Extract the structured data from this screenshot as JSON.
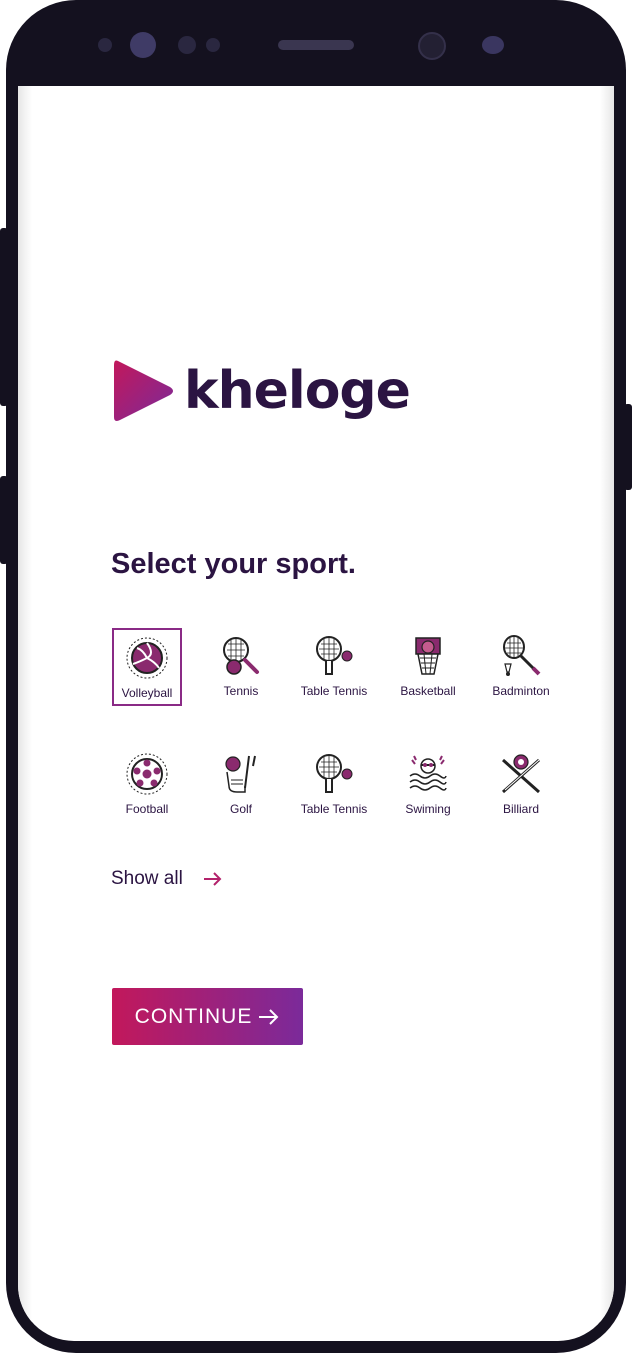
{
  "app": {
    "logo_text": "kheloge"
  },
  "heading": "Select your sport.",
  "sports": [
    {
      "label": "Volleyball",
      "icon": "volleyball-icon",
      "selected": true
    },
    {
      "label": "Tennis",
      "icon": "tennis-icon",
      "selected": false
    },
    {
      "label": "Table Tennis",
      "icon": "table-tennis-icon",
      "selected": false
    },
    {
      "label": "Basketball",
      "icon": "basketball-icon",
      "selected": false
    },
    {
      "label": "Badminton",
      "icon": "badminton-icon",
      "selected": false
    },
    {
      "label": "Football",
      "icon": "football-icon",
      "selected": false
    },
    {
      "label": "Golf",
      "icon": "golf-icon",
      "selected": false
    },
    {
      "label": "Table Tennis",
      "icon": "table-tennis-icon",
      "selected": false
    },
    {
      "label": "Swiming",
      "icon": "swimming-icon",
      "selected": false
    },
    {
      "label": "Billiard",
      "icon": "billiard-icon",
      "selected": false
    }
  ],
  "show_all": {
    "label": "Show all",
    "icon": "arrow-right-icon"
  },
  "continue_button": {
    "label": "CONTINUE",
    "icon": "arrow-right-icon"
  },
  "colors": {
    "brand_dark": "#2b1442",
    "accent_start": "#c2185b",
    "accent_end": "#7b2a9a"
  }
}
